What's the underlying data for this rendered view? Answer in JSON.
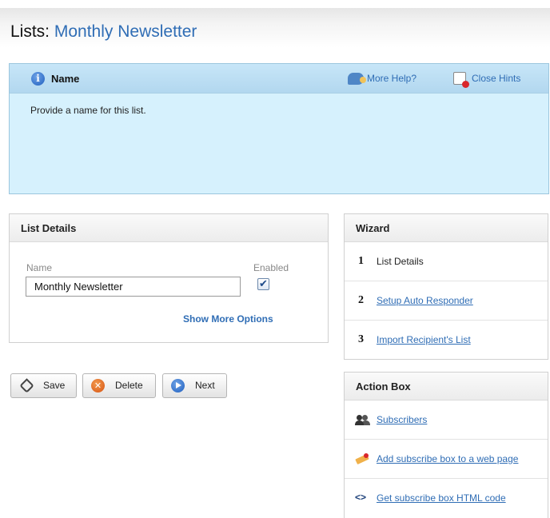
{
  "header": {
    "title_prefix": "Lists:",
    "title_name": "Monthly Newsletter"
  },
  "hint": {
    "title": "Name",
    "more_help": "More Help?",
    "close_hints": "Close Hints",
    "body": "Provide a name for this list.",
    "info_icon_glyph": "i",
    "info_icon": "info-icon",
    "help_icon": "speech-bubble-icon",
    "close_icon": "close-hints-icon"
  },
  "list_details": {
    "title": "List Details",
    "name_label": "Name",
    "enabled_label": "Enabled",
    "name_value": "Monthly Newsletter",
    "enabled_checked": true,
    "check_glyph": "✔",
    "show_more": "Show More Options"
  },
  "buttons": {
    "save": "Save",
    "delete": "Delete",
    "next": "Next",
    "delete_glyph": "✕",
    "save_icon": "tag-icon",
    "delete_icon": "delete-icon",
    "next_icon": "arrow-right-icon"
  },
  "wizard": {
    "title": "Wizard",
    "steps": [
      {
        "num": "1",
        "label": "List Details",
        "link": false
      },
      {
        "num": "2",
        "label": "Setup Auto Responder",
        "link": true
      },
      {
        "num": "3",
        "label": "Import Recipient's List",
        "link": true
      }
    ]
  },
  "action_box": {
    "title": "Action Box",
    "items": [
      {
        "icon": "users-icon",
        "label": "Subscribers"
      },
      {
        "icon": "pencil-icon",
        "label": "Add subscribe box to a web page"
      },
      {
        "icon": "code-icon",
        "label": "Get subscribe box HTML code",
        "glyph": "<>"
      }
    ]
  },
  "colors": {
    "link": "#2f6db5",
    "hint_bg": "#d6f1fd",
    "hint_border": "#9cc6de",
    "delete_icon": "#d65313",
    "next_icon": "#1f5fbf"
  }
}
